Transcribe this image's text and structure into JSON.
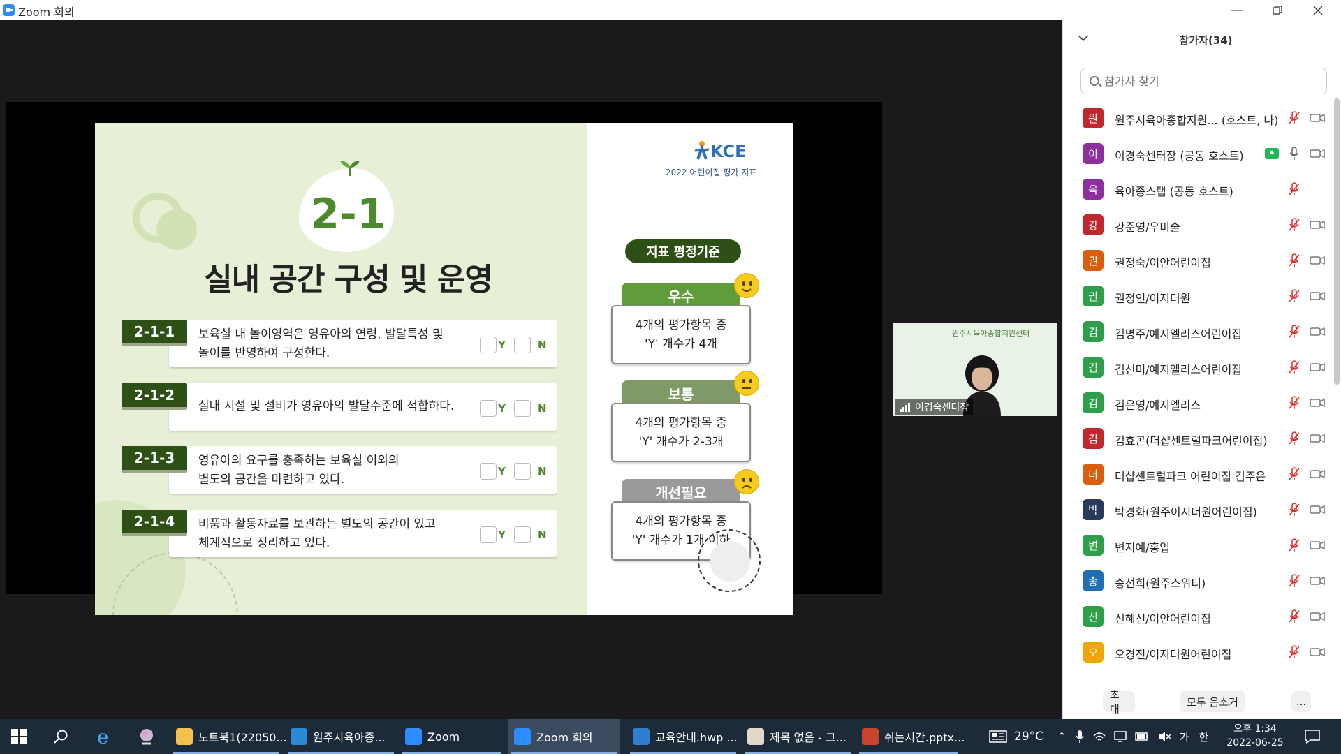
{
  "window": {
    "title": "Zoom 회의"
  },
  "slide": {
    "number": "2-1",
    "title": "실내 공간 구성 및 운영",
    "logo_text": "KCE",
    "subtitle": "2022 어린이집 평가 지표",
    "items": [
      {
        "code": "2-1-1",
        "text_line1": "보육실 내 놀이영역은 영유아의 연령, 발달특성 및",
        "text_line2": "놀이를 반영하여 구성한다.",
        "y": "Y",
        "n": "N"
      },
      {
        "code": "2-1-2",
        "text_line1": "실내 시설 및 설비가 영유아의 발달수준에 적합하다.",
        "text_line2": "",
        "y": "Y",
        "n": "N"
      },
      {
        "code": "2-1-3",
        "text_line1": "영유아의 요구를 충족하는 보육실 이외의",
        "text_line2": "별도의 공간을 마련하고 있다.",
        "y": "Y",
        "n": "N"
      },
      {
        "code": "2-1-4",
        "text_line1": "비품과 활동자료를 보관하는 별도의 공간이 있고",
        "text_line2": "체계적으로 정리하고 있다.",
        "y": "Y",
        "n": "N"
      }
    ],
    "criteria_label": "지표 평정기준",
    "grades": [
      {
        "label": "우수",
        "line1": "4개의 평가항목 중",
        "line2": "'Y' 개수가 4개",
        "color": "#5f9c3a",
        "emoji": "happy"
      },
      {
        "label": "보통",
        "line1": "4개의 평가항목 중",
        "line2": "'Y' 개수가 2-3개",
        "color": "#7f9967",
        "emoji": "neutral"
      },
      {
        "label": "개선필요",
        "line1": "4개의 평가항목 중",
        "line2": "'Y' 개수가 1개 이하",
        "color": "#9a9a9a",
        "emoji": "sad"
      }
    ]
  },
  "video": {
    "name": "이경숙센터장",
    "background_text": "원주시육아종합지원센터"
  },
  "panel": {
    "title": "참가자(34)",
    "search_placeholder": "참가자 찾기",
    "participants": [
      {
        "initial": "원",
        "name": "원주시육아종합지원... (호스트, 나)",
        "color": "#c0282e",
        "muted": true,
        "sharing": false
      },
      {
        "initial": "이",
        "name": "이경숙센터장 (공동 호스트)",
        "color": "#8e2fa0",
        "muted": false,
        "sharing": true
      },
      {
        "initial": "육",
        "name": "육아종스탭 (공동 호스트)",
        "color": "#8e2fa0",
        "muted": true,
        "sharing": false,
        "no_cam": true
      },
      {
        "initial": "강",
        "name": "강준영/우미술",
        "color": "#c0282e",
        "muted": true,
        "sharing": false
      },
      {
        "initial": "권",
        "name": "권정숙/이안어린이집",
        "color": "#d95f0e",
        "muted": true,
        "sharing": false
      },
      {
        "initial": "권",
        "name": "권정인/이지더원",
        "color": "#2e9e4a",
        "muted": true,
        "sharing": false
      },
      {
        "initial": "김",
        "name": "김명주/예지엘리스어린이집",
        "color": "#2e9e4a",
        "muted": true,
        "sharing": false
      },
      {
        "initial": "김",
        "name": "김선미/예지엘리스어린이집",
        "color": "#2e9e4a",
        "muted": true,
        "sharing": false
      },
      {
        "initial": "김",
        "name": "김은영/예지엘리스",
        "color": "#2e9e4a",
        "muted": true,
        "sharing": false
      },
      {
        "initial": "김",
        "name": "김효곤(더샵센트럴파크어린이집)",
        "color": "#c0282e",
        "muted": true,
        "sharing": false
      },
      {
        "initial": "더",
        "name": "더샵센트럴파크 어린이집 김주은",
        "color": "#d95f0e",
        "muted": true,
        "sharing": false
      },
      {
        "initial": "박",
        "name": "박경화(원주이지더원어린이집)",
        "color": "#2a3a5c",
        "muted": true,
        "sharing": false
      },
      {
        "initial": "변",
        "name": "변지예/홍업",
        "color": "#2e9e4a",
        "muted": true,
        "sharing": false
      },
      {
        "initial": "송",
        "name": "송선희(원주스위티)",
        "color": "#1f6fb3",
        "muted": true,
        "sharing": false
      },
      {
        "initial": "신",
        "name": "신혜선/이안어린이집",
        "color": "#2e9e4a",
        "muted": true,
        "sharing": false
      },
      {
        "initial": "오",
        "name": "오경진/이지더원어린이집",
        "color": "#f0a500",
        "muted": true,
        "sharing": false
      }
    ],
    "invite_label": "초대",
    "mute_all_label": "모두 음소거",
    "more_label": "..."
  },
  "taskbar": {
    "items": [
      {
        "label": "노트북1(22050...",
        "icon": "folder-icon",
        "color": "#f2c14e"
      },
      {
        "label": "원주시육아종...",
        "icon": "edge-icon",
        "color": "#2a8ad4"
      },
      {
        "label": "Zoom",
        "icon": "zoom-icon",
        "color": "#2d8cff"
      },
      {
        "label": "Zoom 회의",
        "icon": "zoom-icon",
        "color": "#2d8cff"
      },
      {
        "label": "교육안내.hwp ...",
        "icon": "hwp-icon",
        "color": "#2f7fd0"
      },
      {
        "label": "제목 없음 - 그...",
        "icon": "paint-icon",
        "color": "#e0d8c8"
      },
      {
        "label": "쉬는시간.pptx...",
        "icon": "powerpoint-icon",
        "color": "#c7432a"
      }
    ],
    "weather": "29°C",
    "ime_mode": "가",
    "ime_lang": "한",
    "time": "오후 1:34",
    "date": "2022-06-25"
  }
}
